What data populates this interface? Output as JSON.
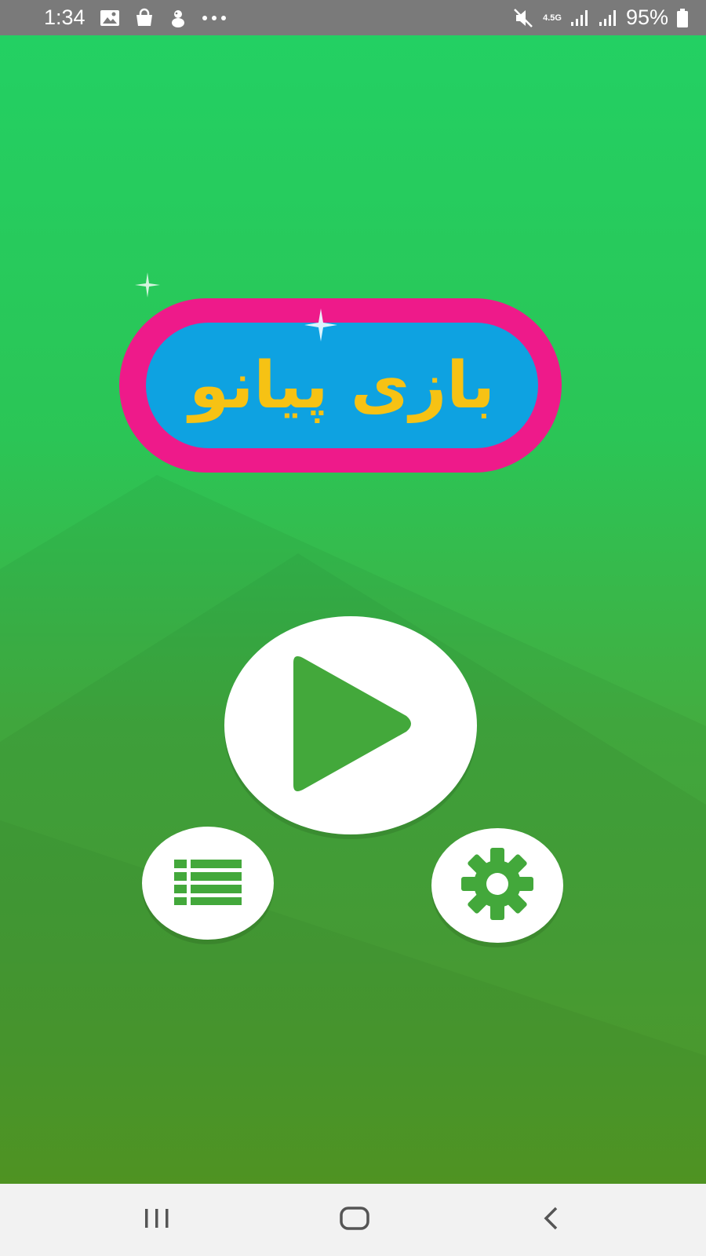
{
  "status_bar": {
    "time": "1:34",
    "network_type": "4.5G",
    "battery_percent": "95%",
    "left_icons": [
      "image-icon",
      "shopping-bag-icon",
      "mascot-icon",
      "more-dots-icon"
    ],
    "right_icons": [
      "mute-icon",
      "network-type-icon",
      "signal-icon",
      "signal-icon",
      "battery-icon"
    ]
  },
  "app": {
    "title": "بازی پیانو",
    "colors": {
      "background_top": "#23d063",
      "background_bottom": "#5aa628",
      "title_border": "#ee1a8a",
      "title_fill": "#0ea2e1",
      "title_text": "#f6c214",
      "button_fill": "#ffffff",
      "button_icon": "#43a83b"
    },
    "buttons": {
      "play": "play-icon",
      "list": "list-icon",
      "settings": "gear-icon"
    }
  },
  "nav_bar": {
    "buttons": [
      "recent-apps-icon",
      "home-icon",
      "back-icon"
    ]
  }
}
